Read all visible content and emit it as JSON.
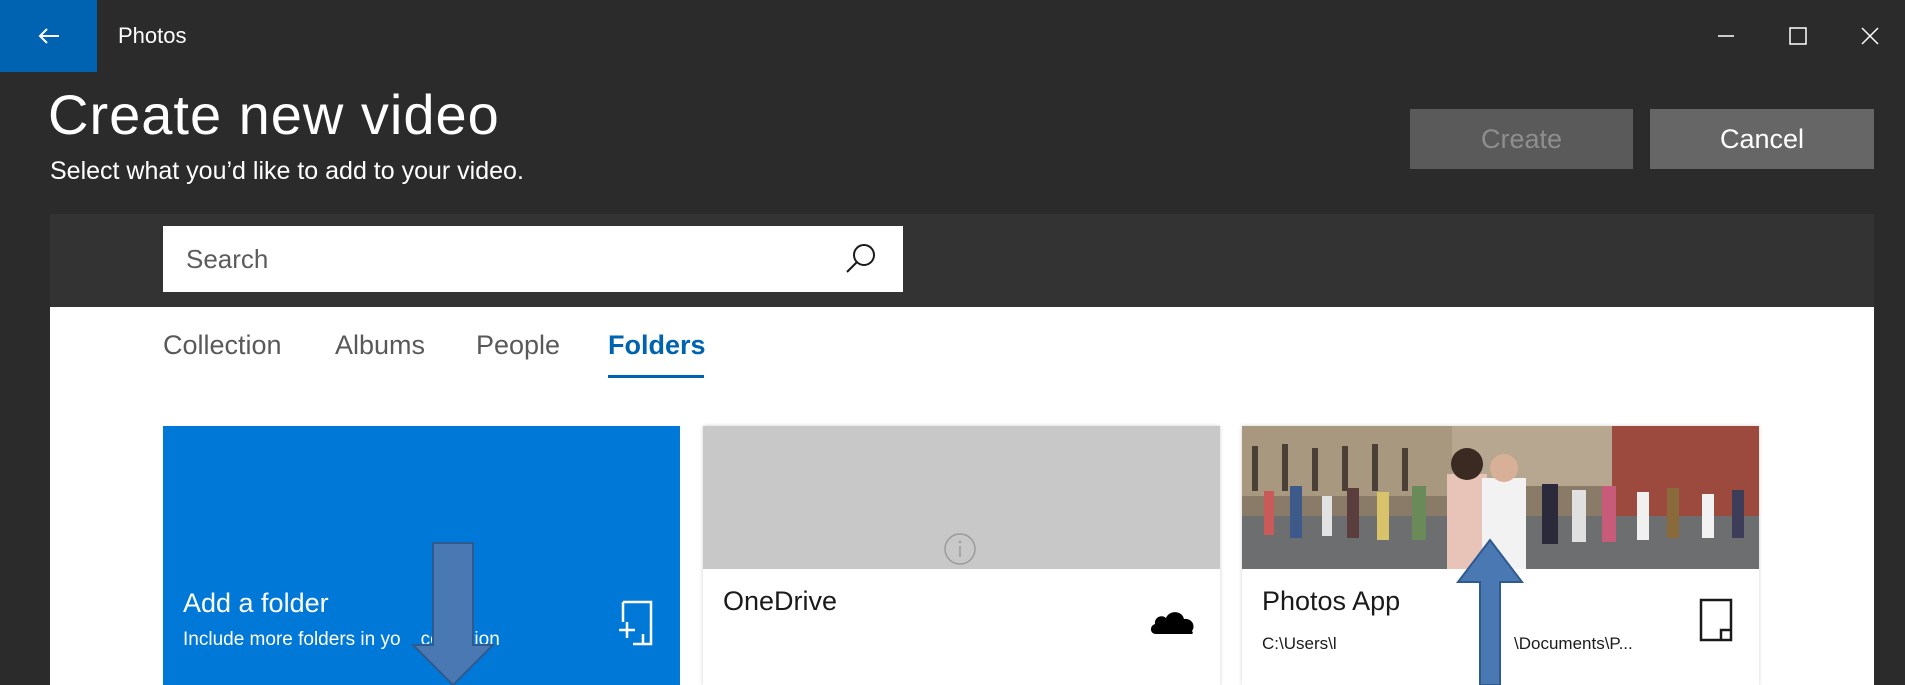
{
  "window": {
    "app_title": "Photos",
    "back_icon": "back-arrow-icon",
    "controls": [
      "minimize-icon",
      "maximize-icon",
      "close-icon"
    ],
    "accent_color": "#0063b1"
  },
  "header": {
    "title": "Create new video",
    "subtitle": "Select what you’d like to add to your video.",
    "create_label": "Create",
    "cancel_label": "Cancel",
    "create_enabled": false
  },
  "search": {
    "placeholder": "Search",
    "value": ""
  },
  "tabs": [
    {
      "label": "Collection",
      "selected": false
    },
    {
      "label": "Albums",
      "selected": false
    },
    {
      "label": "People",
      "selected": false
    },
    {
      "label": "Folders",
      "selected": true
    }
  ],
  "cards": {
    "add_folder": {
      "title": "Add a folder",
      "subtitle": "Include more folders in yo",
      "subtitle_tail": "collection",
      "icon": "add-folder-icon",
      "color": "#0078d7"
    },
    "onedrive": {
      "title": "OneDrive",
      "icons": [
        "info-icon",
        "cloud-icon"
      ]
    },
    "photos_app": {
      "title": "Photos App",
      "path_start": "C:\\Users\\l",
      "path_end": "\\Documents\\P...",
      "icon": "device-icon"
    }
  },
  "annotations": {
    "arrow_color": "#4a78b3",
    "arrows": [
      "down-arrow",
      "up-arrow"
    ]
  }
}
